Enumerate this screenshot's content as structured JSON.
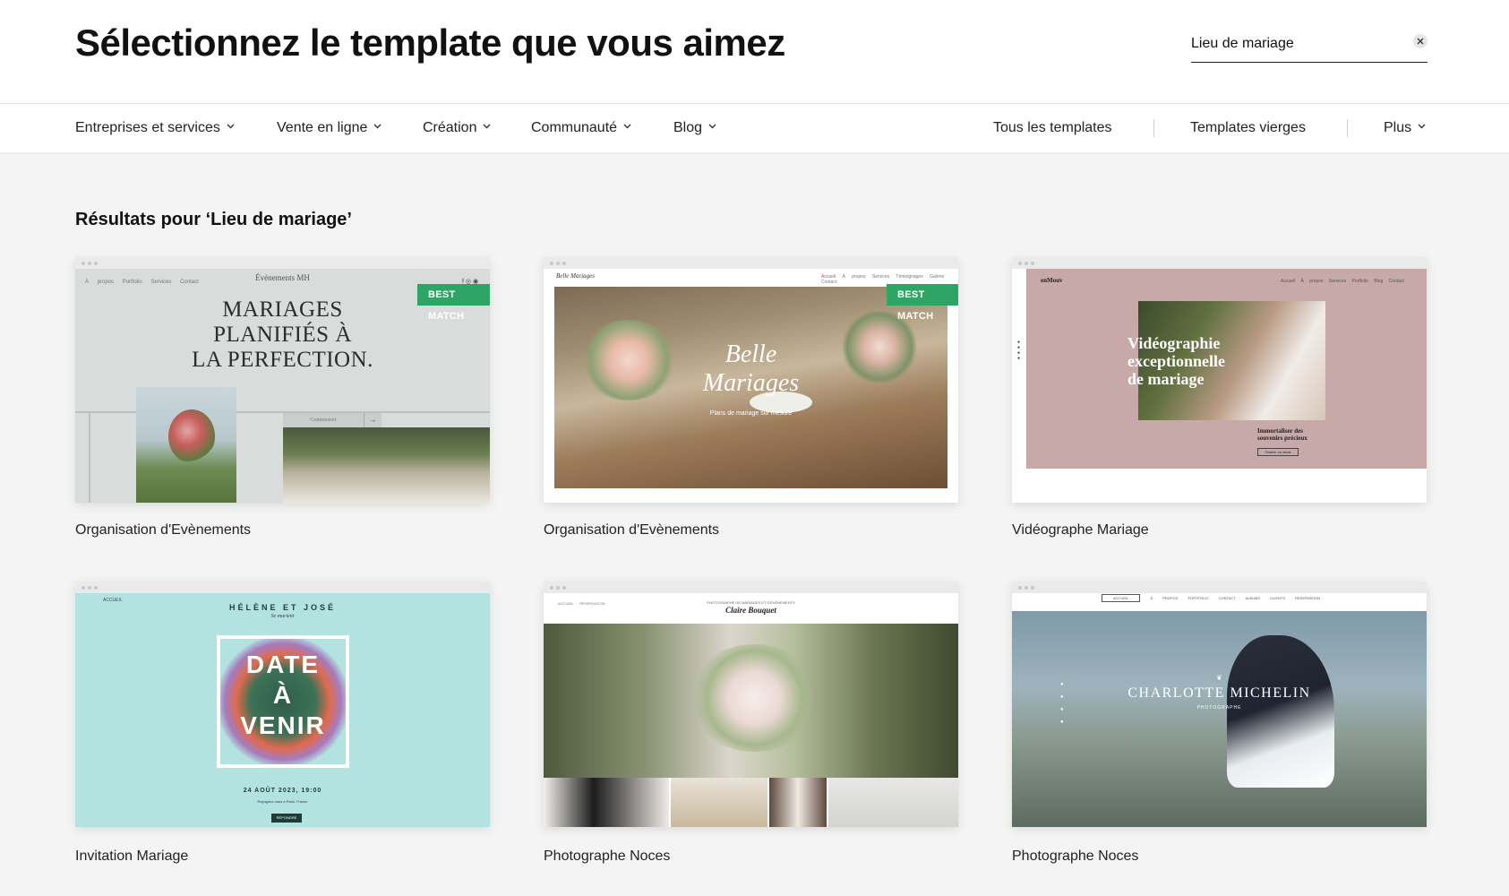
{
  "header": {
    "title": "Sélectionnez le template que vous aimez",
    "search_value": "Lieu de mariage"
  },
  "nav": {
    "left": [
      {
        "label": "Entreprises et services"
      },
      {
        "label": "Vente en ligne"
      },
      {
        "label": "Création"
      },
      {
        "label": "Communauté"
      },
      {
        "label": "Blog"
      }
    ],
    "right": [
      {
        "label": "Tous les templates"
      },
      {
        "label": "Templates vierges"
      },
      {
        "label": "Plus"
      }
    ]
  },
  "results": {
    "title": "Résultats pour ‘Lieu de mariage’",
    "badge_label": "BEST MATCH",
    "cards": [
      {
        "title": "Organisation d'Evènements",
        "best_match": true
      },
      {
        "title": "Organisation d'Evènements",
        "best_match": true
      },
      {
        "title": "Vidéographe Mariage",
        "best_match": false
      },
      {
        "title": "Invitation Mariage",
        "best_match": false
      },
      {
        "title": "Photographe Noces",
        "best_match": false
      },
      {
        "title": "Photographe Noces",
        "best_match": false
      }
    ]
  },
  "previews": {
    "p1": {
      "brand": "Évènements MH",
      "nav": [
        "À propos",
        "Portfolio",
        "Services",
        "Contact"
      ],
      "headline": [
        "MARIAGES",
        "PLANIFIÉS À",
        "LA PERFECTION."
      ],
      "cta": "Commencer"
    },
    "p2": {
      "brand": "Belle Mariages",
      "nav": [
        "Accueil",
        "À propos",
        "Services",
        "Témoignages",
        "Galerie",
        "Contact"
      ],
      "headline": [
        "Belle",
        "Mariages"
      ],
      "subtitle": "Plans de mariage sur mesure"
    },
    "p3": {
      "brand": "enMouv",
      "nav": [
        "Accueil",
        "À propos",
        "Services",
        "Portfolio",
        "Blog",
        "Contact"
      ],
      "headline": [
        "Vidéographie",
        "exceptionnelle",
        "de mariage"
      ],
      "sub": [
        "Immortaliser des",
        "souvenirs précieux"
      ],
      "cta": "Obtenir un devis"
    },
    "p4": {
      "nav": "ACCUEIL",
      "names": "HÉLÈNE ET JOSÉ",
      "sub": "Se marient",
      "headline": [
        "DATE",
        "À",
        "VENIR"
      ],
      "date": "24 AOÛT 2023, 19:00",
      "place": "Rejoignez-nous à Paris, France",
      "cta": "RÉPONDRE"
    },
    "p5": {
      "nav": [
        "ACCUEIL",
        "RÉSERVATION"
      ],
      "tagline": "PHOTOGRAPHE DE MARIAGES ET D'ÉVÉNEMENTS",
      "name": "Claire Bouquet"
    },
    "p6": {
      "nav": [
        "ACCUEIL",
        "À PROPOS",
        "PORTFOLIO",
        "CONTACT",
        "ALBUMS CLIENTS",
        "RÉSERVATION"
      ],
      "name": "CHARLOTTE MICHELIN",
      "role": "PHOTOGRAPHE"
    }
  },
  "colors": {
    "accent_green": "#2fa565",
    "page_bg": "#f3f4f3",
    "preview_teal": "#b3e3e0",
    "preview_pink": "#c7a9a9"
  }
}
